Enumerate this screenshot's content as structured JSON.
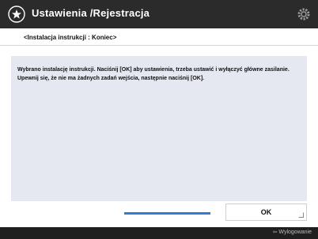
{
  "header": {
    "title": "Ustawienia /Rejestracja",
    "home_icon": "home-icon",
    "settings_icon": "gear-icon"
  },
  "breadcrumb": "<Instalacja instrukcji : Koniec>",
  "message": "Wybrano instalację instrukcji. Naciśnij [OK] aby ustawienia, trzeba ustawić i wyłączyć główne zasilanie. Upewnij się, że nie ma żadnych zadań wejścia, następnie naciśnij [OK].",
  "progress": {
    "fraction": 1.0,
    "color": "#2f7bd6"
  },
  "buttons": {
    "ok_label": "OK"
  },
  "footer": {
    "logout_label": "⇦ Wylogowanie"
  },
  "colors": {
    "titlebar": "#2b2b2b",
    "panel": "#e5e8f0",
    "accent": "#2f7bd6"
  }
}
